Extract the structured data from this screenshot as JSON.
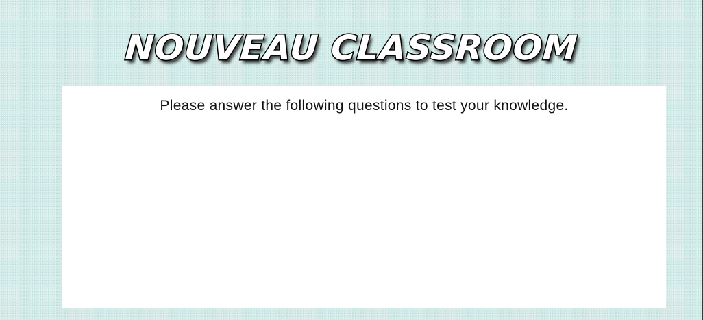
{
  "header": {
    "title": "NOUVEAU CLASSROOM"
  },
  "content": {
    "intro": "Please answer the following questions to test your knowledge."
  },
  "colors": {
    "background": "#d3ece9",
    "panel": "#ffffff",
    "title_fill": "#ffffff",
    "title_outline": "#000000",
    "text": "#111111"
  }
}
